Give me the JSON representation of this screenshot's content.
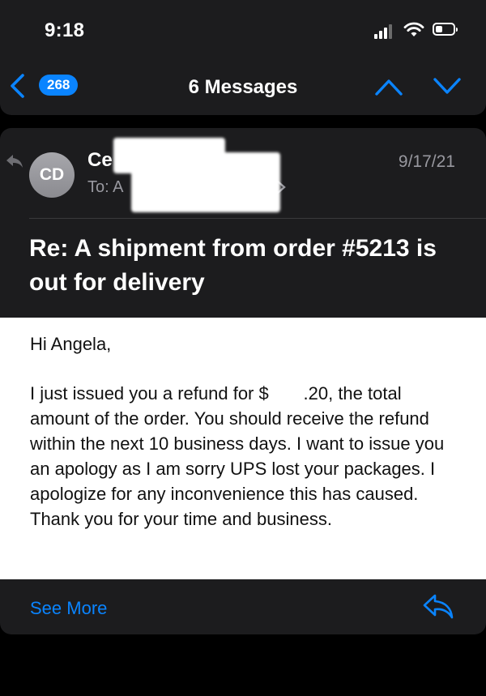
{
  "status_bar": {
    "time": "9:18",
    "icons": [
      "signal-icon",
      "wifi-icon",
      "battery-icon"
    ]
  },
  "nav": {
    "unread_count": "268",
    "title": "6 Messages",
    "icons": [
      "back-chevron-icon",
      "chevron-up-icon",
      "chevron-down-icon"
    ]
  },
  "message": {
    "avatar_initials": "CD",
    "sender_name": "Ce",
    "recipient_line": "To: A",
    "date": "9/17/21",
    "subject": "Re: A shipment from order #5213 is out for delivery",
    "greeting": "Hi Angela,",
    "body": "I just issued you a refund for $       .20, the total amount of the order.  You should receive the refund within the next 10 business days.  I want to issue you an apology as I am sorry UPS lost your packages.  I apologize for any inconvenience this has caused.  Thank you for your time and business."
  },
  "footer": {
    "see_more_label": "See More",
    "reply_icon": "reply-icon"
  },
  "colors": {
    "background": "#000000",
    "surface": "#1c1c1e",
    "accent": "#0a84ff",
    "secondary_text": "#98989f",
    "body_background": "#ffffff"
  }
}
